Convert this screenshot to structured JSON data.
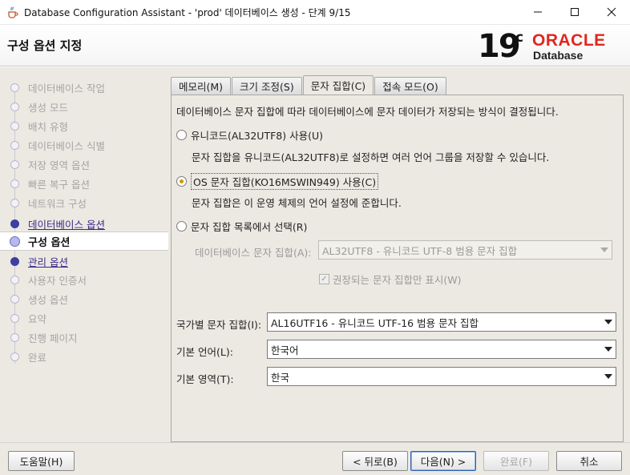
{
  "window": {
    "title": "Database Configuration Assistant - 'prod' 데이터베이스 생성 - 단계 9/15",
    "app_icon": "java-cup-icon",
    "controls": [
      "minimize-icon",
      "maximize-icon",
      "close-icon"
    ]
  },
  "header": {
    "title": "구성 옵션 지정",
    "logo": {
      "version": "19",
      "suffix": "c",
      "brand": "ORACLE",
      "product": "Database"
    }
  },
  "sidebar": {
    "items": [
      {
        "label": "데이터베이스 작업",
        "state": "disabled"
      },
      {
        "label": "생성 모드",
        "state": "disabled"
      },
      {
        "label": "배치 유형",
        "state": "disabled"
      },
      {
        "label": "데이터베이스 식별",
        "state": "disabled"
      },
      {
        "label": "저장 영역 옵션",
        "state": "disabled"
      },
      {
        "label": "빠른 복구 옵션",
        "state": "disabled"
      },
      {
        "label": "네트워크 구성",
        "state": "disabled"
      },
      {
        "label": "데이터베이스 옵션",
        "state": "link"
      },
      {
        "label": "구성 옵션",
        "state": "current"
      },
      {
        "label": "관리 옵션",
        "state": "link"
      },
      {
        "label": "사용자 인증서",
        "state": "disabled"
      },
      {
        "label": "생성 옵션",
        "state": "disabled"
      },
      {
        "label": "요약",
        "state": "disabled"
      },
      {
        "label": "진행 페이지",
        "state": "disabled"
      },
      {
        "label": "완료",
        "state": "disabled"
      }
    ]
  },
  "tabs": [
    {
      "label": "메모리(M)",
      "active": false
    },
    {
      "label": "크기 조정(S)",
      "active": false
    },
    {
      "label": "문자 집합(C)",
      "active": true
    },
    {
      "label": "접속 모드(O)",
      "active": false
    }
  ],
  "charset": {
    "description": "데이터베이스 문자 집합에 따라 데이터베이스에 문자 데이터가 저장되는 방식이 결정됩니다.",
    "options": [
      {
        "label": "유니코드(AL32UTF8) 사용(U)",
        "sub": "문자 집합을 유니코드(AL32UTF8)로 설정하면 여러 언어 그룹을 저장할 수 있습니다.",
        "checked": false
      },
      {
        "label": "OS 문자 집합(KO16MSWIN949) 사용(C)",
        "sub": "문자 집합은 이 운영 체제의 언어 설정에 준합니다.",
        "checked": true
      },
      {
        "label": "문자 집합 목록에서 선택(R)",
        "sub": "",
        "checked": false
      }
    ],
    "db_charset_label": "데이터베이스 문자 집합(A):",
    "db_charset_value": "AL32UTF8 - 유니코드 UTF-8 범용 문자 집합",
    "recommended_only_label": "권장되는 문자 집합만 표시(W)",
    "recommended_only_checked": true
  },
  "national": {
    "label": "국가별 문자 집합(I):",
    "value": "AL16UTF16 - 유니코드 UTF-16 범용 문자 집합"
  },
  "language": {
    "label": "기본 언어(L):",
    "value": "한국어"
  },
  "territory": {
    "label": "기본 영역(T):",
    "value": "한국"
  },
  "footer": {
    "help": "도움말(H)",
    "back": "< 뒤로(B)",
    "next": "다음(N) >",
    "finish": "완료(F)",
    "cancel": "취소"
  }
}
